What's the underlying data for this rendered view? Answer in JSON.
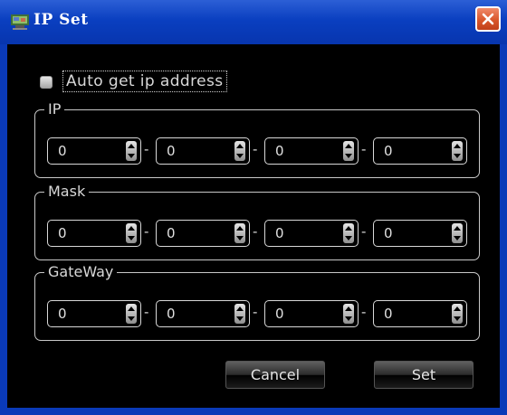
{
  "window": {
    "title": "IP Set",
    "app_icon": "network-icon",
    "close_icon": "close-icon"
  },
  "auto_ip": {
    "label": "Auto get ip address",
    "checked": false
  },
  "groups": [
    {
      "title": "IP",
      "octets": [
        "0",
        "0",
        "0",
        "0"
      ],
      "separator": "-"
    },
    {
      "title": "Mask",
      "octets": [
        "0",
        "0",
        "0",
        "0"
      ],
      "separator": "-"
    },
    {
      "title": "GateWay",
      "octets": [
        "0",
        "0",
        "0",
        "0"
      ],
      "separator": "-"
    }
  ],
  "buttons": {
    "cancel": "Cancel",
    "set": "Set"
  },
  "colors": {
    "titlebar": "#0a3fc0",
    "close": "#d9562b",
    "background": "#000000",
    "text": "#d8d8d8"
  }
}
